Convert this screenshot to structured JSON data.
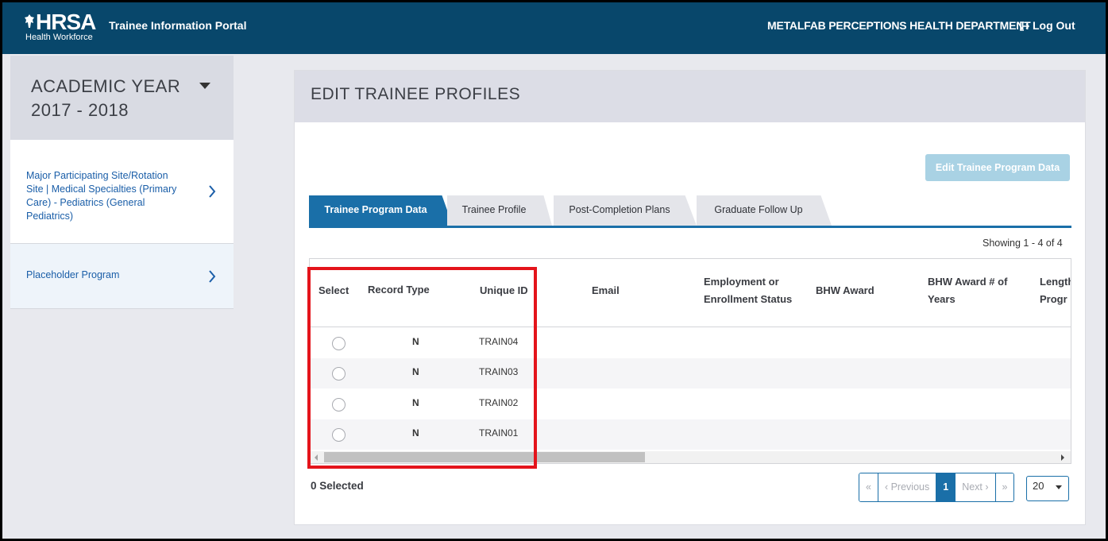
{
  "header": {
    "logo_text": "HRSA",
    "logo_sub": "Health Workforce",
    "portal_title": "Trainee Information Portal",
    "org_name": "METALFAB PERCEPTIONS HEALTH DEPARTMENT",
    "logout_label": "Log Out"
  },
  "sidebar": {
    "academic_year": "ACADEMIC YEAR 2017 - 2018",
    "items": [
      {
        "label": "Major Participating Site/Rotation Site | Medical Specialties (Primary Care) - Pediatrics (General Pediatrics)"
      },
      {
        "label": "Placeholder Program"
      }
    ]
  },
  "main": {
    "title": "EDIT TRAINEE PROFILES",
    "edit_button": "Edit Trainee Program Data",
    "tabs": [
      {
        "label": "Trainee Program Data",
        "active": true
      },
      {
        "label": "Trainee Profile",
        "active": false
      },
      {
        "label": "Post-Completion Plans",
        "active": false
      },
      {
        "label": "Graduate Follow Up",
        "active": false
      }
    ],
    "showing": "Showing 1 - 4 of 4",
    "columns": {
      "select": "Select",
      "record_type": "Record Type",
      "unique_id": "Unique ID",
      "email": "Email",
      "employment_1": "Employment or",
      "employment_2": "Enrollment Status",
      "bhw_award": "BHW Award",
      "bhw_years_1": "BHW Award # of",
      "bhw_years_2": "Years",
      "length_1": "Length",
      "length_2": "Progr"
    },
    "rows": [
      {
        "record_type": "N",
        "unique_id": "TRAIN04"
      },
      {
        "record_type": "N",
        "unique_id": "TRAIN03"
      },
      {
        "record_type": "N",
        "unique_id": "TRAIN02"
      },
      {
        "record_type": "N",
        "unique_id": "TRAIN01"
      }
    ],
    "selected_count": "0 Selected",
    "pager": {
      "first": "«",
      "previous": "‹ Previous",
      "current": "1",
      "next": "Next ›",
      "last": "»",
      "page_size": "20"
    }
  },
  "colors": {
    "header_bg": "#08476b",
    "accent": "#1a6fa8",
    "highlight": "#e4141b"
  }
}
